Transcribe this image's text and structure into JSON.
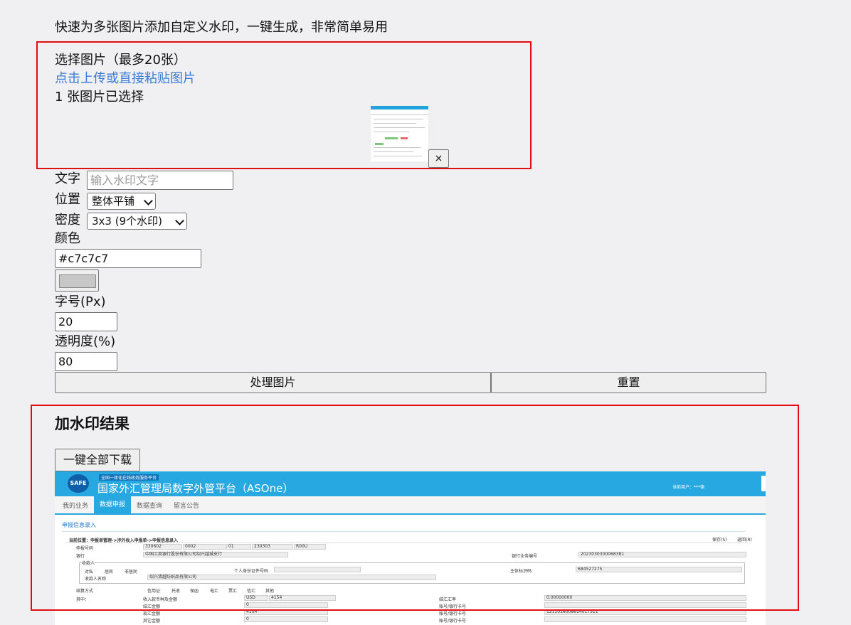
{
  "intro": "快速为多张图片添加自定义水印，一键生成，非常简单易用",
  "upload": {
    "label": "选择图片（最多20张）",
    "link": "点击上传或直接粘贴图片",
    "count_text": "1 张图片已选择",
    "remove_label": "×"
  },
  "form": {
    "text_label": "文字",
    "text_placeholder": "输入水印文字",
    "text_value": "",
    "position_label": "位置",
    "position_value": "整体平铺",
    "density_label": "密度",
    "density_value": "3x3 (9个水印)",
    "color_label": "颜色",
    "color_value": "#c7c7c7",
    "font_size_label": "字号(Px)",
    "font_size_value": "20",
    "opacity_label": "透明度(%)",
    "opacity_value": "80",
    "process_label": "处理图片",
    "reset_label": "重置"
  },
  "result": {
    "heading": "加水印结果",
    "download_label": "一键全部下载",
    "preview": {
      "logo": "SAFE",
      "banner": "全国一体化在线政务服务平台",
      "title": "国家外汇管理局数字外管平台（ASOne）",
      "user": "当前用户：***德",
      "tabs": [
        "我的业务",
        "数据申报",
        "数据查询",
        "留言公告"
      ],
      "section": "申报信息录入",
      "breadcrumb": "当前位置：申报单管理->涉外收入申报单->申报信息录入",
      "save": "保存(S)",
      "back": "返回(R)",
      "row1_label": "申报号码",
      "row1_values": [
        "330602",
        "0002",
        "01",
        "230303",
        "R00U"
      ],
      "bank_label": "银行",
      "bank_value": "中国工商银行股份有限公司绍兴越城支行",
      "bizno_label": "银行业务编号",
      "bizno_value": "2023030300068381",
      "payee_group": "收款人",
      "payee_types": [
        "对私",
        "居民",
        "非居民"
      ],
      "id_label": "个人身份证件号码",
      "org_label": "主体标识码",
      "org_value": "684527275",
      "payee_name_label": "收款人名称",
      "payee_name_value": "绍兴清越纺织品有限公司",
      "settle_label": "结算方式",
      "settle_types": [
        "信用证",
        "托收",
        "保函",
        "电汇",
        "票汇",
        "信汇",
        "其他"
      ],
      "of_which": "其中：",
      "amount_label": "收入款币种及金额",
      "currency": "USD",
      "amount": "4154",
      "rate_label": "结汇汇率",
      "rate_value": "0.00000000",
      "fx_label": "结汇金额",
      "fx_value": "0",
      "acct_label": "账号/银行卡号",
      "spot_label": "现汇金额",
      "spot_value": "4154",
      "spot_acct": "1211016008614017311",
      "other_label": "其它金额",
      "other_value": "0"
    }
  }
}
